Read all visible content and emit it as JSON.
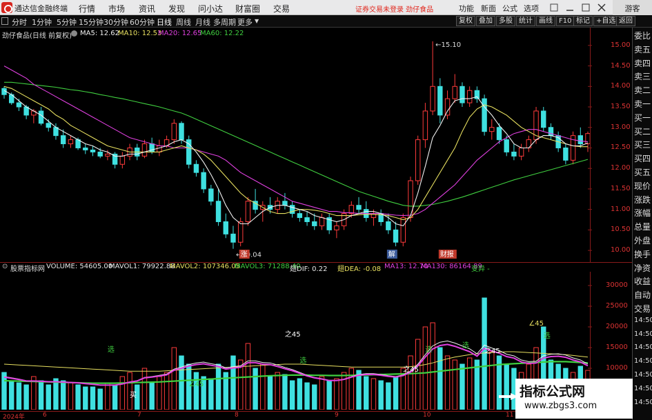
{
  "menubar": {
    "app_name": "通达信金融终端",
    "items": [
      "行情",
      "市场",
      "资讯",
      "发现",
      "问小达",
      "财富圈",
      "交易"
    ],
    "notice": "证券交易未登录  劲仔食品",
    "right_items": [
      "功能",
      "新面",
      "公式",
      "选项"
    ],
    "guest": "游客"
  },
  "periodbar": {
    "periods": [
      "分时",
      "1分钟",
      "5分钟",
      "15分钟",
      "30分钟",
      "60分钟",
      "日线",
      "周线",
      "月线",
      "多周期",
      "更多"
    ],
    "active": "日线",
    "tools": [
      "复权",
      "叠加",
      "多股",
      "统计",
      "画线",
      "F10",
      "标记",
      "+自选",
      "返回"
    ]
  },
  "main": {
    "stock_title": "劲仔食品(日线 前复权)",
    "ma": [
      {
        "label": "MA5: 12.62",
        "color": "#f0f0f0"
      },
      {
        "label": "MA10: 12.53",
        "color": "#e8e060"
      },
      {
        "label": "MA20: 12.65",
        "color": "#e040e0"
      },
      {
        "label": "MA60: 12.22",
        "color": "#40d040"
      }
    ],
    "price_ticks": [
      "15.00",
      "14.50",
      "14.00",
      "13.50",
      "13.00",
      "12.50",
      "12.00",
      "11.50",
      "11.00",
      "10.50",
      "10.00"
    ],
    "high_label": "15.10",
    "low_label": "10.04",
    "event_marks": [
      "涨",
      "解",
      "财报"
    ]
  },
  "sub": {
    "indicator_name": "股票指标网",
    "items": [
      {
        "label": "VOLUME: 54605.00",
        "color": "#e8e8e8"
      },
      {
        "label": "MAVOL1: 79922.88",
        "color": "#e8e8e8"
      },
      {
        "label": "MAVOL2: 107346.05",
        "color": "#e8e060"
      },
      {
        "label": "MAVOL3: 71288.40",
        "color": "#40d040"
      },
      {
        "label": "翅DIF: 0.22",
        "color": "#e8e8e8"
      },
      {
        "label": "翅DEA: -0.08",
        "color": "#e8e060"
      },
      {
        "label": "MA13: 12.70",
        "color": "#e040e0"
      },
      {
        "label": "MA130: 86164.89",
        "color": "#e040e0"
      },
      {
        "label": "变异 -",
        "color": "#40d040"
      }
    ],
    "vol_ticks": [
      "30000",
      "25000",
      "20000",
      "15000",
      "10000"
    ],
    "annotations": [
      "选",
      "选",
      "选",
      "选",
      "选",
      "之45",
      "之45",
      "之45",
      "∠45",
      "∠45",
      "买"
    ]
  },
  "date_axis": [
    "2024年",
    "6",
    "7",
    "8",
    "9",
    "10",
    "11"
  ],
  "sidetabs": [
    "委比",
    "卖五",
    "卖四",
    "卖三",
    "卖二",
    "卖一",
    "买一",
    "买二",
    "买三",
    "买四",
    "买五",
    "现价",
    "涨跌",
    "涨幅",
    "总量",
    "外盘",
    "换手",
    "净资",
    "收益",
    "自动",
    "交易",
    "14:50",
    "14:50",
    "14:50",
    "14:50",
    "14:50",
    "14:50",
    "14:50"
  ],
  "watermark": {
    "title": "指标公式网",
    "url": "www.zbgs3.com"
  },
  "chart_data": {
    "type": "candlestick",
    "title": "劲仔食品(日线 前复权)",
    "ylim": [
      9.8,
      15.3
    ],
    "ohlc_approx": [
      [
        13.95,
        14.0,
        13.7,
        13.8
      ],
      [
        13.8,
        13.85,
        13.55,
        13.6
      ],
      [
        13.6,
        13.7,
        13.4,
        13.5
      ],
      [
        13.5,
        13.55,
        13.2,
        13.3
      ],
      [
        13.3,
        13.45,
        13.1,
        13.4
      ],
      [
        13.4,
        13.5,
        13.05,
        13.1
      ],
      [
        13.1,
        13.2,
        12.9,
        13.0
      ],
      [
        13.0,
        13.1,
        12.7,
        12.8
      ],
      [
        12.8,
        12.95,
        12.5,
        12.6
      ],
      [
        12.6,
        12.8,
        12.5,
        12.7
      ],
      [
        12.7,
        12.75,
        12.45,
        12.5
      ],
      [
        12.5,
        12.6,
        12.35,
        12.45
      ],
      [
        12.45,
        12.55,
        12.3,
        12.4
      ],
      [
        12.4,
        12.5,
        12.25,
        12.3
      ],
      [
        12.3,
        12.45,
        12.2,
        12.35
      ],
      [
        12.35,
        12.4,
        12.0,
        12.1
      ],
      [
        12.1,
        12.4,
        12.0,
        12.3
      ],
      [
        12.3,
        12.6,
        12.2,
        12.5
      ],
      [
        12.5,
        12.6,
        12.2,
        12.3
      ],
      [
        12.3,
        12.7,
        12.25,
        12.6
      ],
      [
        12.6,
        12.75,
        12.35,
        12.4
      ],
      [
        12.4,
        12.7,
        12.3,
        12.55
      ],
      [
        12.55,
        12.8,
        12.5,
        12.7
      ],
      [
        12.7,
        13.2,
        12.6,
        13.1
      ],
      [
        13.1,
        13.15,
        12.6,
        12.7
      ],
      [
        12.7,
        12.8,
        12.0,
        12.1
      ],
      [
        12.1,
        12.2,
        11.8,
        11.9
      ],
      [
        11.9,
        12.0,
        11.4,
        11.5
      ],
      [
        11.5,
        11.6,
        11.1,
        11.2
      ],
      [
        11.2,
        11.5,
        10.6,
        10.7
      ],
      [
        10.7,
        10.9,
        10.3,
        10.4
      ],
      [
        10.4,
        10.6,
        10.04,
        10.2
      ],
      [
        10.2,
        10.8,
        10.1,
        10.7
      ],
      [
        10.7,
        11.3,
        10.6,
        11.2
      ],
      [
        11.2,
        11.5,
        10.9,
        11.0
      ],
      [
        11.0,
        11.2,
        10.7,
        11.1
      ],
      [
        11.1,
        11.3,
        10.9,
        11.0
      ],
      [
        11.0,
        11.3,
        10.9,
        11.2
      ],
      [
        11.2,
        11.4,
        11.0,
        11.1
      ],
      [
        11.1,
        11.2,
        10.8,
        10.9
      ],
      [
        10.9,
        11.0,
        10.7,
        10.8
      ],
      [
        10.8,
        10.95,
        10.6,
        10.7
      ],
      [
        10.7,
        10.9,
        10.5,
        10.6
      ],
      [
        10.6,
        10.9,
        10.5,
        10.8
      ],
      [
        10.8,
        10.9,
        10.4,
        10.5
      ],
      [
        10.5,
        10.7,
        10.3,
        10.6
      ],
      [
        10.6,
        11.0,
        10.5,
        10.9
      ],
      [
        10.9,
        11.2,
        10.8,
        11.1
      ],
      [
        11.1,
        11.3,
        10.9,
        11.0
      ],
      [
        11.0,
        11.2,
        10.7,
        10.8
      ],
      [
        10.8,
        11.0,
        10.6,
        10.9
      ],
      [
        10.9,
        11.0,
        10.6,
        10.7
      ],
      [
        10.7,
        10.9,
        10.4,
        10.5
      ],
      [
        10.5,
        10.7,
        10.1,
        10.2
      ],
      [
        10.2,
        10.9,
        10.1,
        10.8
      ],
      [
        10.8,
        11.8,
        10.7,
        11.7
      ],
      [
        11.7,
        12.8,
        11.6,
        12.7
      ],
      [
        12.7,
        13.6,
        12.5,
        13.4
      ],
      [
        13.4,
        15.1,
        13.3,
        14.0
      ],
      [
        14.0,
        14.2,
        13.1,
        13.3
      ],
      [
        13.3,
        13.9,
        13.2,
        13.7
      ],
      [
        13.7,
        14.3,
        13.6,
        14.0
      ],
      [
        14.0,
        14.1,
        13.5,
        13.6
      ],
      [
        13.6,
        14.0,
        13.5,
        13.9
      ],
      [
        13.9,
        14.0,
        13.6,
        13.7
      ],
      [
        13.7,
        13.8,
        12.8,
        12.9
      ],
      [
        12.9,
        13.2,
        12.7,
        13.0
      ],
      [
        13.0,
        13.1,
        12.6,
        12.7
      ],
      [
        12.7,
        12.8,
        12.3,
        12.4
      ],
      [
        12.4,
        12.6,
        12.2,
        12.3
      ],
      [
        12.3,
        12.6,
        12.2,
        12.5
      ],
      [
        12.5,
        12.8,
        12.4,
        12.7
      ],
      [
        12.7,
        13.5,
        12.6,
        13.4
      ],
      [
        13.4,
        13.5,
        12.9,
        13.0
      ],
      [
        13.0,
        13.1,
        12.7,
        12.8
      ],
      [
        12.8,
        12.9,
        12.4,
        12.5
      ],
      [
        12.5,
        12.6,
        12.1,
        12.2
      ],
      [
        12.2,
        12.9,
        12.1,
        12.8
      ],
      [
        12.8,
        13.0,
        12.5,
        12.6
      ],
      [
        12.6,
        12.9,
        12.4,
        12.85
      ]
    ],
    "ma5": [
      13.9,
      13.8,
      13.65,
      13.5,
      13.4,
      13.3,
      13.15,
      13.0,
      12.9,
      12.8,
      12.7,
      12.6,
      12.55,
      12.45,
      12.4,
      12.3,
      12.3,
      12.35,
      12.35,
      12.4,
      12.45,
      12.5,
      12.55,
      12.65,
      12.7,
      12.6,
      12.4,
      12.15,
      11.85,
      11.5,
      11.1,
      10.8,
      10.65,
      10.65,
      10.8,
      10.95,
      11.05,
      11.1,
      11.1,
      11.05,
      11.0,
      10.95,
      10.85,
      10.8,
      10.75,
      10.7,
      10.75,
      10.85,
      10.9,
      10.95,
      10.95,
      10.9,
      10.8,
      10.65,
      10.6,
      10.85,
      11.4,
      12.05,
      12.75,
      13.05,
      13.4,
      13.65,
      13.7,
      13.7,
      13.75,
      13.5,
      13.3,
      13.05,
      12.85,
      12.6,
      12.5,
      12.5,
      12.7,
      12.8,
      12.8,
      12.75,
      12.6,
      12.55,
      12.55,
      12.62
    ],
    "ma10": [
      14.0,
      13.95,
      13.85,
      13.75,
      13.65,
      13.55,
      13.45,
      13.3,
      13.2,
      13.05,
      12.95,
      12.85,
      12.75,
      12.65,
      12.55,
      12.5,
      12.45,
      12.4,
      12.4,
      12.4,
      12.4,
      12.4,
      12.45,
      12.5,
      12.55,
      12.5,
      12.45,
      12.35,
      12.2,
      12.0,
      11.8,
      11.6,
      11.4,
      11.25,
      11.15,
      11.05,
      10.95,
      10.9,
      10.9,
      10.95,
      11.0,
      11.0,
      10.98,
      10.95,
      10.9,
      10.85,
      10.85,
      10.85,
      10.87,
      10.88,
      10.88,
      10.87,
      10.85,
      10.8,
      10.75,
      10.8,
      11.0,
      11.3,
      11.6,
      11.9,
      12.2,
      12.5,
      12.9,
      13.25,
      13.45,
      13.55,
      13.5,
      13.4,
      13.3,
      13.15,
      13.0,
      12.9,
      12.8,
      12.75,
      12.7,
      12.65,
      12.6,
      12.55,
      12.53,
      12.53
    ],
    "ma20": [
      14.5,
      14.4,
      14.3,
      14.2,
      14.05,
      13.95,
      13.85,
      13.75,
      13.65,
      13.55,
      13.45,
      13.35,
      13.25,
      13.15,
      13.05,
      12.95,
      12.85,
      12.75,
      12.7,
      12.65,
      12.6,
      12.55,
      12.55,
      12.5,
      12.5,
      12.5,
      12.45,
      12.4,
      12.35,
      12.3,
      12.2,
      12.05,
      11.9,
      11.8,
      11.7,
      11.6,
      11.5,
      11.4,
      11.3,
      11.2,
      11.15,
      11.1,
      11.05,
      11.0,
      10.95,
      10.95,
      10.92,
      10.92,
      10.9,
      10.9,
      10.9,
      10.9,
      10.88,
      10.86,
      10.85,
      10.86,
      10.9,
      11.0,
      11.15,
      11.3,
      11.45,
      11.6,
      11.8,
      12.0,
      12.2,
      12.35,
      12.5,
      12.65,
      12.75,
      12.85,
      12.9,
      12.95,
      12.95,
      12.9,
      12.85,
      12.8,
      12.75,
      12.7,
      12.67,
      12.65
    ],
    "ma60": [
      14.1,
      14.1,
      14.08,
      14.06,
      14.04,
      14.02,
      14.0,
      13.98,
      13.95,
      13.92,
      13.9,
      13.87,
      13.84,
      13.8,
      13.77,
      13.73,
      13.7,
      13.66,
      13.62,
      13.58,
      13.54,
      13.5,
      13.45,
      13.4,
      13.35,
      13.28,
      13.2,
      13.12,
      13.04,
      12.96,
      12.88,
      12.8,
      12.72,
      12.64,
      12.56,
      12.48,
      12.4,
      12.32,
      12.24,
      12.16,
      12.08,
      12.0,
      11.92,
      11.84,
      11.76,
      11.68,
      11.6,
      11.52,
      11.44,
      11.38,
      11.32,
      11.26,
      11.2,
      11.15,
      11.1,
      11.08,
      11.08,
      11.1,
      11.12,
      11.16,
      11.2,
      11.25,
      11.3,
      11.36,
      11.42,
      11.48,
      11.54,
      11.6,
      11.66,
      11.72,
      11.77,
      11.82,
      11.87,
      11.92,
      11.97,
      12.02,
      12.07,
      12.12,
      12.17,
      12.22
    ],
    "volume": [
      9000,
      7000,
      6500,
      6000,
      8000,
      7000,
      6000,
      7500,
      7000,
      6500,
      6000,
      5500,
      5500,
      5000,
      6500,
      6000,
      8000,
      9000,
      6000,
      10000,
      6500,
      8000,
      9000,
      15000,
      13000,
      11000,
      9000,
      8000,
      7500,
      11000,
      9000,
      13000,
      12000,
      16000,
      10000,
      11000,
      8000,
      9000,
      8500,
      7000,
      7500,
      6500,
      6000,
      8000,
      7000,
      7500,
      9000,
      10000,
      9500,
      8000,
      7500,
      7000,
      6500,
      8000,
      10000,
      13000,
      17000,
      20000,
      21000,
      15000,
      13000,
      12000,
      11000,
      12500,
      12000,
      27000,
      14000,
      13000,
      11000,
      10000,
      9000,
      11000,
      15000,
      20000,
      12000,
      11000,
      10000,
      9000,
      10500,
      9500
    ],
    "mavol1": [
      8000,
      7700,
      7400,
      7000,
      7000,
      6900,
      6800,
      6800,
      6700,
      6600,
      6500,
      6300,
      6100,
      5900,
      5900,
      5900,
      6200,
      6700,
      7000,
      7800,
      8000,
      8300,
      8600,
      9800,
      10300,
      10900,
      11300,
      11500,
      11100,
      10800,
      10100,
      10400,
      10600,
      11800,
      11800,
      11400,
      11300,
      10800,
      10200,
      9700,
      9000,
      8300,
      7800,
      7500,
      7100,
      7100,
      7400,
      8000,
      8500,
      8700,
      8700,
      8500,
      8200,
      8000,
      8400,
      9300,
      11000,
      13300,
      15400,
      16300,
      16600,
      16100,
      15400,
      14700,
      13500,
      15600,
      14900,
      14300,
      13400,
      13000,
      12000,
      11600,
      11700,
      13000,
      13400,
      13500,
      13200,
      12500,
      12000,
      11000
    ],
    "mavol2": [
      11000,
      10900,
      10800,
      10700,
      10600,
      10500,
      10400,
      10300,
      10200,
      10100,
      10000,
      9900,
      9800,
      9700,
      9600,
      9500,
      9400,
      9300,
      9300,
      9300,
      9300,
      9300,
      9400,
      9500,
      9600,
      9700,
      9800,
      9900,
      10000,
      10100,
      10200,
      10300,
      10400,
      10500,
      10600,
      10700,
      10800,
      10900,
      11000,
      11000,
      11000,
      10900,
      10800,
      10700,
      10600,
      10500,
      10400,
      10300,
      10300,
      10300,
      10300,
      10300,
      10300,
      10300,
      10300,
      10400,
      10600,
      10900,
      11300,
      11800,
      12300,
      12700,
      13000,
      13300,
      13500,
      13700,
      13800,
      13900,
      14000,
      14000,
      13900,
      13800,
      13700,
      13600,
      13500,
      13400,
      13300,
      13100,
      12900,
      12700
    ],
    "mavol3": [
      7000,
      6950,
      6900,
      6850,
      6800,
      6750,
      6700,
      6650,
      6600,
      6550,
      6500,
      6450,
      6400,
      6400,
      6400,
      6400,
      6450,
      6500,
      6550,
      6600,
      6650,
      6700,
      6800,
      6900,
      7000,
      7100,
      7200,
      7300,
      7400,
      7500,
      7600,
      7700,
      7800,
      7900,
      8000,
      8100,
      8200,
      8250,
      8300,
      8350,
      8350,
      8350,
      8300,
      8300,
      8250,
      8250,
      8250,
      8300,
      8350,
      8400,
      8450,
      8500,
      8550,
      8600,
      8650,
      8700,
      8800,
      8900,
      9100,
      9300,
      9500,
      9700,
      9900,
      10100,
      10300,
      10500,
      10700,
      10900,
      11000,
      11100,
      11200,
      11300,
      11400,
      11500,
      11600,
      11600,
      11600,
      11500,
      11400,
      11300
    ]
  }
}
